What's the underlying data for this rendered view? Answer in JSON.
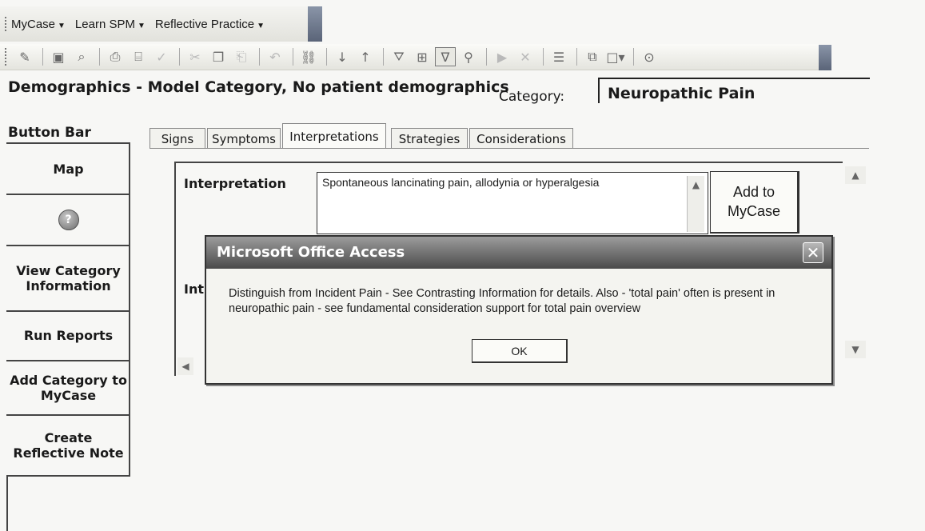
{
  "menubar": {
    "items": [
      {
        "label": "MyCase"
      },
      {
        "label": "Learn SPM"
      },
      {
        "label": "Reflective Practice"
      }
    ]
  },
  "toolbar": {
    "icons": [
      "design-view-icon",
      "save-icon",
      "search-icon",
      "print-icon",
      "print-preview-icon",
      "spelling-icon",
      "cut-icon",
      "copy-icon",
      "paste-icon",
      "undo-icon",
      "insert-hyperlink-icon",
      "sort-ascending-icon",
      "sort-descending-icon",
      "filter-by-selection-icon",
      "filter-by-form-icon",
      "toggle-filter-icon",
      "find-icon",
      "new-record-icon",
      "delete-record-icon",
      "properties-icon",
      "database-window-icon",
      "new-object-icon",
      "help-icon"
    ]
  },
  "header": {
    "title": "Demographics - Model Category, No patient demographics",
    "category_label": "Category:",
    "category_value": "Neuropathic Pain"
  },
  "button_bar": {
    "title": "Button Bar",
    "map": "Map",
    "view_category": "View Category Information",
    "run_reports": "Run Reports",
    "add_category": "Add Category to MyCase",
    "create_reflective": "Create Reflective Note"
  },
  "tabs": [
    {
      "label": "Signs",
      "active": false
    },
    {
      "label": "Symptoms",
      "active": false
    },
    {
      "label": "Interpretations",
      "active": true
    },
    {
      "label": "Strategies",
      "active": false
    },
    {
      "label": "Considerations",
      "active": false
    }
  ],
  "form": {
    "interpretation_label": "Interpretation",
    "interpretation_label_partial": "Int",
    "interpretation_value": "Spontaneous lancinating pain, allodynia or hyperalgesia",
    "add_button": "Add to MyCase"
  },
  "dialog": {
    "title": "Microsoft Office Access",
    "message": "Distinguish from Incident Pain - See Contrasting Information for details. Also - 'total pain' often is present in neuropathic pain - see fundamental consideration support for total pain overview",
    "ok": "OK",
    "close": "✕"
  },
  "colors": {
    "background": "#f7f7f5",
    "dialog_title_bar": "#4a4a4a",
    "border": "#444444"
  }
}
